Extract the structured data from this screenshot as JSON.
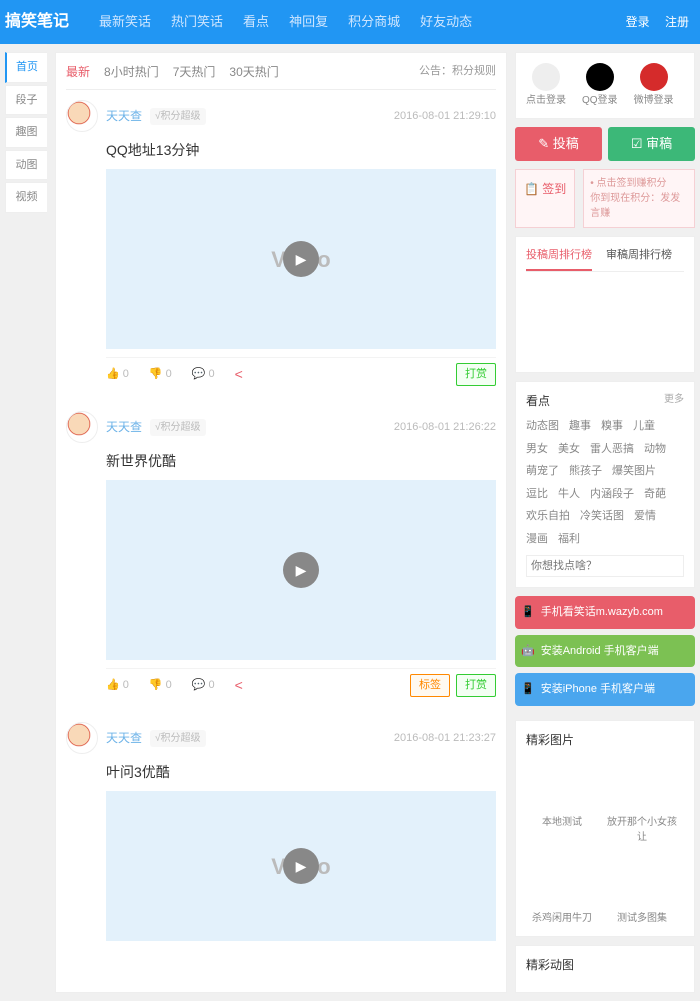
{
  "header": {
    "logo": "搞笑笔记",
    "nav": [
      "最新笑话",
      "热门笑话",
      "看点",
      "神回复",
      "积分商城",
      "好友动态"
    ],
    "login": "登录",
    "register": "注册"
  },
  "leftTabs": [
    "首页",
    "段子",
    "趣图",
    "动图",
    "视频"
  ],
  "sortTabs": [
    "最新",
    "8小时热门",
    "7天热门",
    "30天热门"
  ],
  "announce": "公告：积分规则",
  "posts": [
    {
      "author": "天天查",
      "meta": "√积分超级",
      "time": "2016-08-01 21:29:10",
      "title": "QQ地址13分钟",
      "tags": [
        "打赏"
      ],
      "tagStyles": [
        "tag-green"
      ],
      "like": "0",
      "dislike": "0",
      "comment": "0"
    },
    {
      "author": "天天查",
      "meta": "√积分超级",
      "time": "2016-08-01 21:26:22",
      "title": "新世界优酷",
      "tags": [
        "标签",
        "打赏"
      ],
      "tagStyles": [
        "tag-orange",
        "tag-green"
      ],
      "like": "0",
      "dislike": "0",
      "comment": "0"
    },
    {
      "author": "天天查",
      "meta": "√积分超级",
      "time": "2016-08-01 21:23:27",
      "title": "叶问3优酷",
      "tags": [],
      "tagStyles": [],
      "like": "0",
      "dislike": "0",
      "comment": "0"
    }
  ],
  "loginIcons": {
    "click": "点击登录",
    "qq": "QQ登录",
    "weibo": "微博登录"
  },
  "buttons": {
    "post": "✎ 投稿",
    "review": "☑ 审稿"
  },
  "signin": {
    "label": "📋 签到",
    "line1": "• 点击签到赚积分",
    "line2": "你到现在积分：发发言赚"
  },
  "rankTabs": [
    "投稿周排行榜",
    "审稿周排行榜"
  ],
  "kandian": {
    "title": "看点",
    "more": "更多",
    "tags": [
      "动态图",
      "趣事",
      "糗事",
      "儿童",
      "男女",
      "美女",
      "雷人恶搞",
      "动物",
      "萌宠了",
      "熊孩子",
      "爆笑图片",
      "逗比",
      "牛人",
      "内涵段子",
      "奇葩",
      "欢乐自拍",
      "冷笑话图",
      "爱情",
      "漫画",
      "福利"
    ],
    "placeholder": "你想找点啥？"
  },
  "apps": {
    "m": "手机看笑话m.wazyb.com",
    "android": "安装Android 手机客户端",
    "iphone": "安装iPhone 手机客户端"
  },
  "pics": {
    "title": "精彩图片",
    "items": [
      "本地测试",
      "放开那个小女孩让",
      "杀鸡闲用牛刀",
      "测试多图集"
    ]
  },
  "gif": {
    "title": "精彩动图"
  }
}
